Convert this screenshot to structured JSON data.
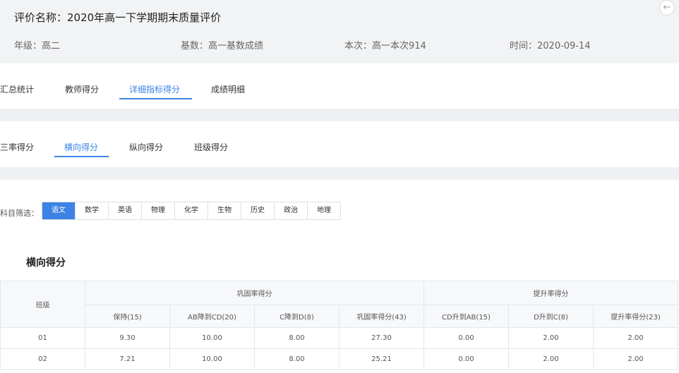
{
  "header": {
    "title": "评价名称：2020年高一下学期期末质量评价",
    "grade": "年级：高二",
    "base": "基数：高一基数成绩",
    "current": "本次：高一本次914",
    "time": "时间：2020-09-14",
    "back_icon": "←"
  },
  "main_tabs": [
    {
      "label": "汇总统计",
      "active": false
    },
    {
      "label": "教师得分",
      "active": false
    },
    {
      "label": "详细指标得分",
      "active": true
    },
    {
      "label": "成绩明细",
      "active": false
    }
  ],
  "sub_tabs": [
    {
      "label": "三率得分",
      "active": false
    },
    {
      "label": "横向得分",
      "active": true
    },
    {
      "label": "纵向得分",
      "active": false
    },
    {
      "label": "班级得分",
      "active": false
    }
  ],
  "filter": {
    "label": "科目筛选：",
    "subjects": [
      "语文",
      "数学",
      "英语",
      "物理",
      "化学",
      "生物",
      "历史",
      "政治",
      "地理"
    ],
    "selected": "语文"
  },
  "section_title": "横向得分",
  "table": {
    "class_header": "班级",
    "group1": "巩固率得分",
    "group2": "提升率得分",
    "columns": [
      "保持(15)",
      "AB降到CD(20)",
      "C降到D(8)",
      "巩固率得分(43)",
      "CD升到AB(15)",
      "D升到C(8)",
      "提升率得分(23)"
    ],
    "rows": [
      [
        "01",
        "9.30",
        "10.00",
        "8.00",
        "27.30",
        "0.00",
        "2.00",
        "2.00"
      ],
      [
        "02",
        "7.21",
        "10.00",
        "8.00",
        "25.21",
        "0.00",
        "2.00",
        "2.00"
      ]
    ]
  },
  "colors": {
    "accent": "#3c83e5",
    "header_bg": "#f2f3f5"
  }
}
